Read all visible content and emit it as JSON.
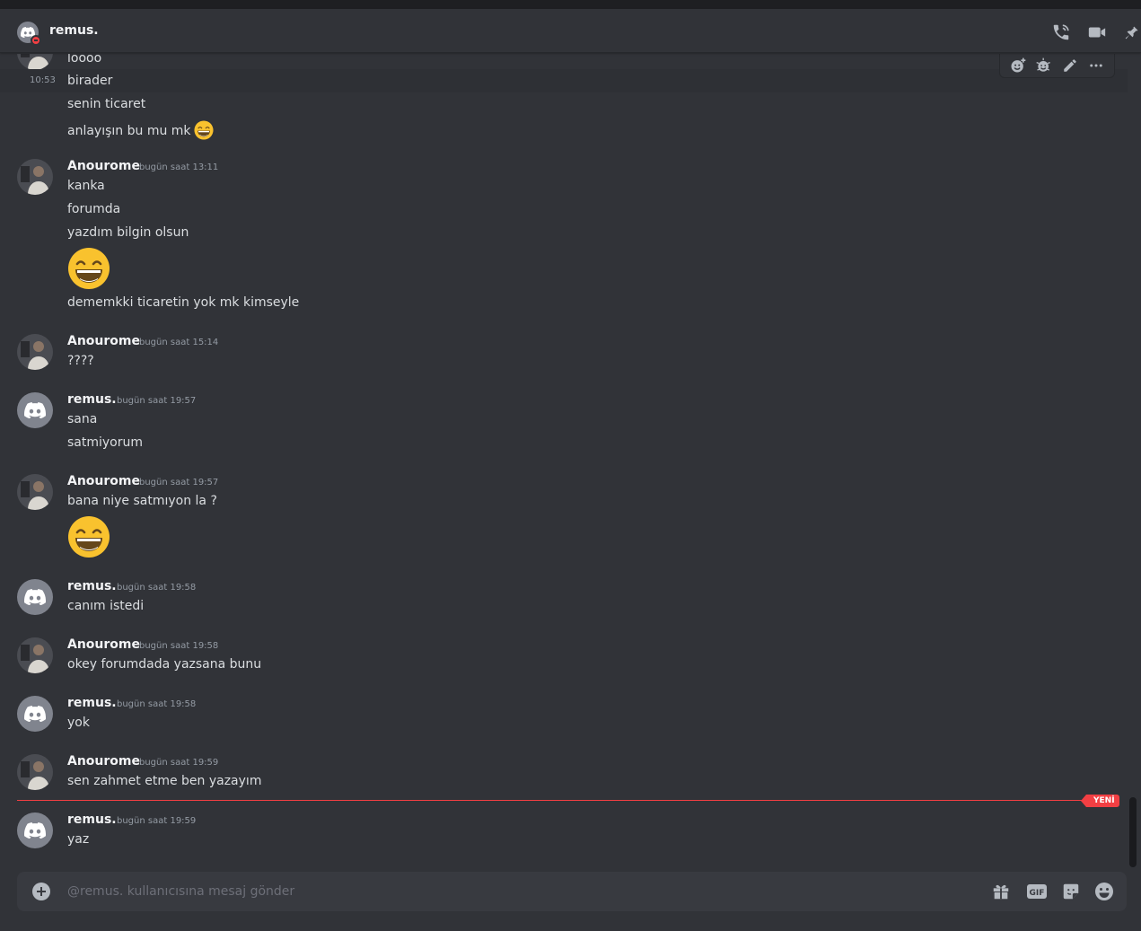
{
  "header": {
    "title": "remus."
  },
  "messages_top": [
    {
      "text": "loooo"
    },
    {
      "time": "10:53",
      "text": "birader"
    },
    {
      "text": "senin ticaret"
    },
    {
      "text": "anlayışın bu  mu mk"
    }
  ],
  "groups": [
    {
      "author": "Anourome",
      "timestamp": "bugün saat 13:11",
      "lines": [
        "kanka",
        "forumda",
        "yazdım bilgin olsun",
        "dememkki ticaretin yok mk kimseyle"
      ]
    },
    {
      "author": "Anourome",
      "timestamp": "bugün saat 15:14",
      "lines": [
        "????"
      ]
    },
    {
      "author": "remus.",
      "timestamp": "bugün saat 19:57",
      "lines": [
        "sana",
        "satmiyorum"
      ]
    },
    {
      "author": "Anourome",
      "timestamp": "bugün saat 19:57",
      "lines": [
        "bana niye satmıyon la ?"
      ]
    },
    {
      "author": "remus.",
      "timestamp": "bugün saat 19:58",
      "lines": [
        "canım istedi"
      ]
    },
    {
      "author": "Anourome",
      "timestamp": "bugün saat 19:58",
      "lines": [
        "okey forumdada yazsana bunu"
      ]
    },
    {
      "author": "remus.",
      "timestamp": "bugün saat 19:58",
      "lines": [
        "yok"
      ]
    },
    {
      "author": "Anourome",
      "timestamp": "bugün saat 19:59",
      "lines": [
        "sen zahmet etme ben yazayım"
      ]
    },
    {
      "author": "remus.",
      "timestamp": "bugün saat 19:59",
      "lines": [
        "yaz"
      ]
    }
  ],
  "new_badge": "YENİ",
  "composer": {
    "placeholder": "@remus. kullanıcısına mesaj gönder",
    "gif_label": "GIF"
  },
  "icons": {
    "header": [
      "voice-call-icon",
      "video-call-icon",
      "pin-icon"
    ],
    "toolbar": [
      "add-reaction-icon",
      "super-reaction-icon",
      "edit-icon",
      "more-icon"
    ],
    "composer": [
      "attach-plus-icon",
      "gift-icon",
      "gif-icon",
      "sticker-icon",
      "emoji-icon"
    ]
  },
  "colors": {
    "background": "#313338",
    "composer": "#383a40",
    "new_divider": "#f23f43",
    "emoji": "#f9c22e"
  }
}
